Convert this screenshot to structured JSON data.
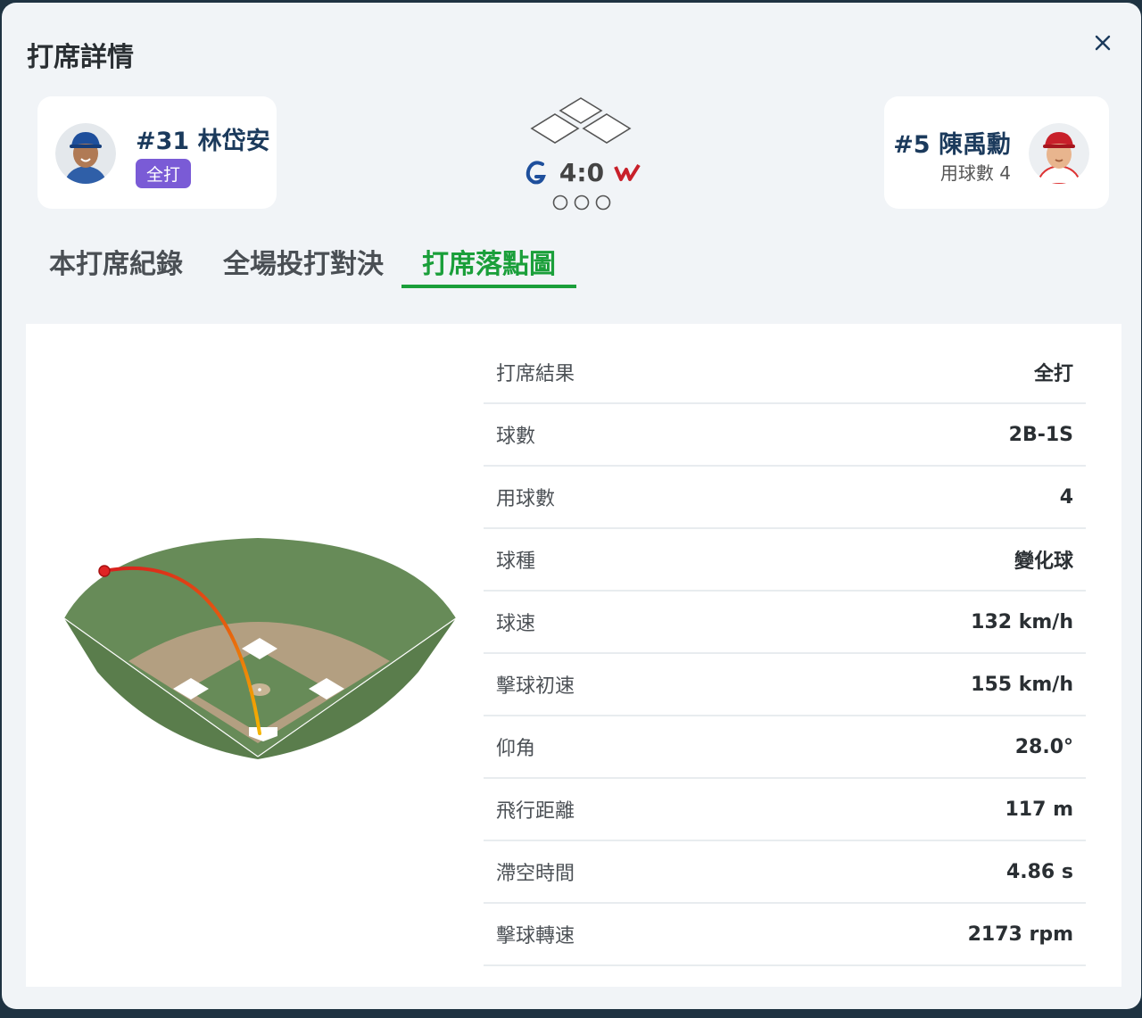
{
  "modal": {
    "title": "打席詳情"
  },
  "batter": {
    "name": "#31 林岱安",
    "result_badge": "全打"
  },
  "pitcher": {
    "name": "#5 陳禹勳",
    "pitch_count": "用球數 4"
  },
  "scoreboard": {
    "score": "4:0",
    "outs_shown": 3
  },
  "tabs": [
    {
      "label": "本打席紀錄",
      "active": false
    },
    {
      "label": "全場投打對決",
      "active": false
    },
    {
      "label": "打席落點圖",
      "active": true
    }
  ],
  "stats": [
    {
      "label": "打席結果",
      "value": "全打"
    },
    {
      "label": "球數",
      "value": "2B-1S"
    },
    {
      "label": "用球數",
      "value": "4"
    },
    {
      "label": "球種",
      "value": "變化球"
    },
    {
      "label": "球速",
      "value": "132 km/h"
    },
    {
      "label": "擊球初速",
      "value": "155 km/h"
    },
    {
      "label": "仰角",
      "value": "28.0°"
    },
    {
      "label": "飛行距離",
      "value": "117 m"
    },
    {
      "label": "滯空時間",
      "value": "4.86 s"
    },
    {
      "label": "擊球轉速",
      "value": "2173 rpm"
    }
  ],
  "colors": {
    "active_tab": "#1a9f3a",
    "badge": "#7a5bd6",
    "player_name": "#1b3a5c",
    "outfield": "#668a58",
    "infield": "#b39f81"
  },
  "icons": {
    "close": "close-icon",
    "bases": "bases-diamond-icon",
    "home_team": "team-g-logo-icon",
    "away_team": "team-w-logo-icon"
  }
}
